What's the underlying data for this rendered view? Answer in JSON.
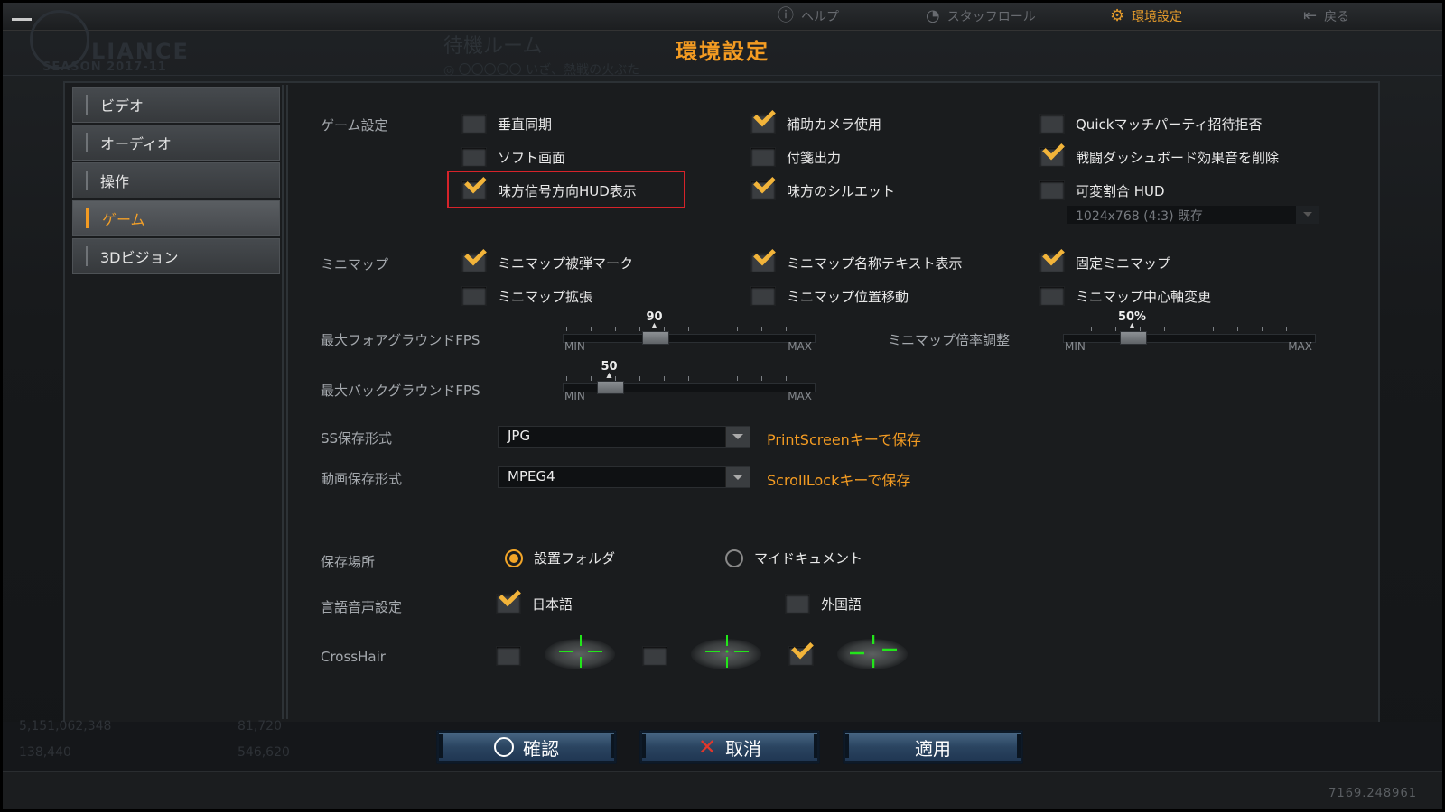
{
  "topbar": {
    "help_label": "ヘルプ",
    "staffroll_label": "スタッフロール",
    "settings_label": "環境設定",
    "back_label": "戻る"
  },
  "background": {
    "logo_text": "LIANCE",
    "logo_sub": "SEASON 2017-11",
    "room_title": "待機ルーム",
    "room_sub": "◎ 〇〇〇〇〇 いざ、熱戦の火ぶた"
  },
  "title": "環境設定",
  "sidebar": {
    "items": [
      {
        "label": "ビデオ"
      },
      {
        "label": "オーディオ"
      },
      {
        "label": "操作"
      },
      {
        "label": "ゲーム",
        "active": true
      },
      {
        "label": "3Dビジョン"
      }
    ]
  },
  "game": {
    "section_label": "ゲーム設定",
    "options": [
      {
        "label": "垂直同期",
        "checked": false
      },
      {
        "label": "補助カメラ使用",
        "checked": true
      },
      {
        "label": "Quickマッチパーティ招待拒否",
        "checked": false
      },
      {
        "label": "ソフト画面",
        "checked": false
      },
      {
        "label": "付箋出力",
        "checked": false
      },
      {
        "label": "戦闘ダッシュボード効果音を削除",
        "checked": true
      },
      {
        "label": "味方信号方向HUD表示",
        "checked": true
      },
      {
        "label": "味方のシルエット",
        "checked": true
      },
      {
        "label": "可変割合 HUD",
        "checked": false
      }
    ],
    "hud_resolution": "1024x768 (4:3) 既存"
  },
  "minimap": {
    "section_label": "ミニマップ",
    "options": [
      {
        "label": "ミニマップ被弾マーク",
        "checked": true
      },
      {
        "label": "ミニマップ名称テキスト表示",
        "checked": true
      },
      {
        "label": "固定ミニマップ",
        "checked": true
      },
      {
        "label": "ミニマップ拡張",
        "checked": false
      },
      {
        "label": "ミニマップ位置移動",
        "checked": false
      },
      {
        "label": "ミニマップ中心軸変更",
        "checked": false
      }
    ]
  },
  "sliders": {
    "fg_fps": {
      "label": "最大フォアグラウンドFPS",
      "value": "90",
      "level": 0.35
    },
    "bg_fps": {
      "label": "最大バックグラウンドFPS",
      "value": "50",
      "level": 0.15
    },
    "minimap_scale": {
      "label": "ミニマップ倍率調整",
      "value": "50%",
      "level": 0.25
    },
    "min_label": "MIN",
    "max_label": "MAX"
  },
  "screenshot": {
    "label": "SS保存形式",
    "value": "JPG",
    "hint": "PrintScreenキーで保存"
  },
  "video": {
    "label": "動画保存形式",
    "value": "MPEG4",
    "hint": "ScrollLockキーで保存"
  },
  "save_location": {
    "label": "保存場所",
    "options": [
      {
        "label": "設置フォルダ",
        "selected": true
      },
      {
        "label": "マイドキュメント",
        "selected": false
      }
    ]
  },
  "voice_language": {
    "label": "言語音声設定",
    "options": [
      {
        "label": "日本語",
        "checked": true
      },
      {
        "label": "外国語",
        "checked": false
      }
    ]
  },
  "crosshair": {
    "label": "CrossHair",
    "options": [
      {
        "checked": false,
        "icon": "crosshair-cross-icon"
      },
      {
        "checked": false,
        "icon": "crosshair-dot-icon"
      },
      {
        "checked": true,
        "icon": "crosshair-gap-icon"
      }
    ],
    "color": "#22e61a"
  },
  "buttons": {
    "confirm": "確認",
    "cancel": "取消",
    "apply": "適用"
  },
  "background_stats": {
    "credits": "5,151,062,348",
    "points": "81,720",
    "exp": "138,440",
    "other": "546,620"
  },
  "version": "7169.248961"
}
